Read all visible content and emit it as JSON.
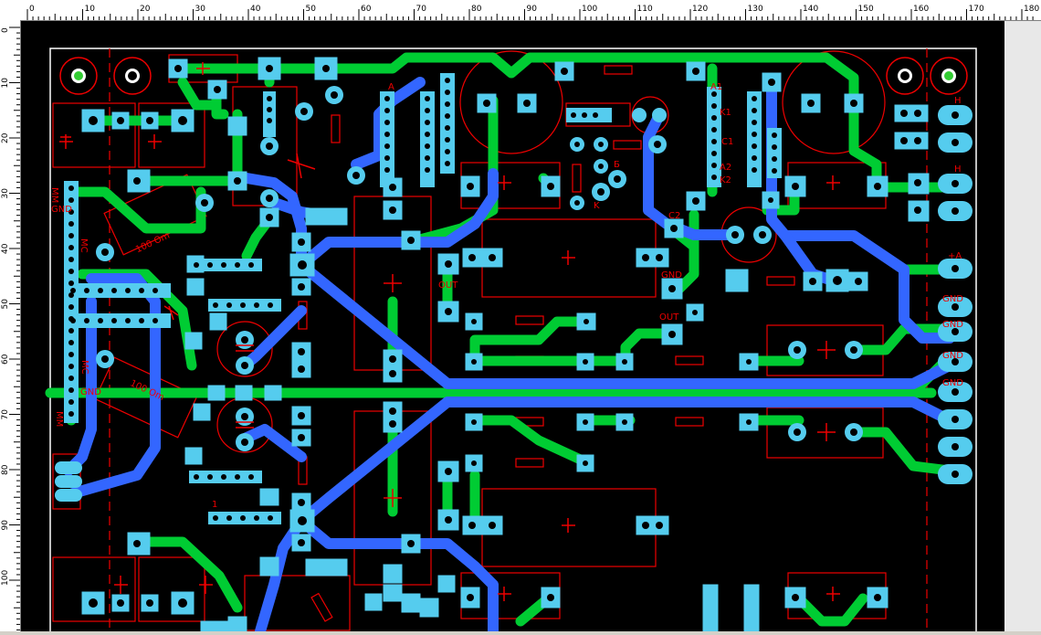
{
  "ruler": {
    "unit": "мм",
    "top_labels": [
      "0",
      "10",
      "20",
      "30",
      "40",
      "50",
      "60",
      "70",
      "80",
      "90",
      "100",
      "110",
      "120",
      "130",
      "140",
      "150",
      "160",
      "170",
      "180"
    ],
    "left_labels": [
      "0",
      "10",
      "20",
      "30",
      "40",
      "50",
      "60",
      "70",
      "80",
      "90",
      "100"
    ]
  },
  "board": {
    "labels": {
      "r1": "100 Om",
      "r2": "100 Om",
      "gnd1": "GND",
      "gnd2": "GND",
      "gnd3": "GND",
      "out1": "OUT",
      "out2": "OUT",
      "c2": "C2",
      "c1": "C1",
      "a1": "A1",
      "k1": "K1",
      "k2": "K2",
      "a2": "A2",
      "mm1": "MM",
      "mm2": "MM",
      "mc1": "MC",
      "mc2": "MC",
      "plus_a": "+A",
      "gnd_c1": "GND",
      "gnd_c2": "GND",
      "gnd_c3": "GND",
      "gnd_c4": "GND",
      "h1": "H",
      "h2": "H",
      "a": "A",
      "k": "K",
      "b": "Б",
      "one": "1"
    }
  }
}
